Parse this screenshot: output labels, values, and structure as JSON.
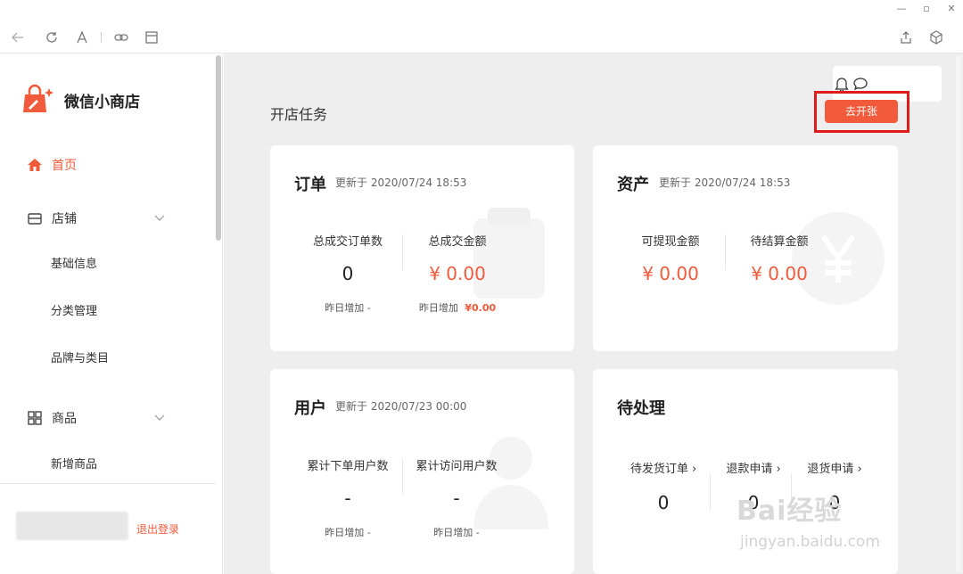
{
  "window": {
    "controls": [
      "minimize",
      "restore",
      "close"
    ]
  },
  "toolbar": {
    "icons": [
      "back-icon",
      "refresh-icon",
      "font-icon",
      "link-icon",
      "layout-icon",
      "share-icon",
      "cube-icon"
    ]
  },
  "sidebar": {
    "brand": "微信小商店",
    "nav": {
      "home": "首页",
      "store": "店铺",
      "store_sub": [
        "基础信息",
        "分类管理",
        "品牌与类目"
      ],
      "goods": "商品",
      "goods_sub": [
        "新增商品"
      ]
    },
    "logout": "退出登录"
  },
  "main": {
    "title": "开店任务",
    "open_button": "去开张",
    "cards": {
      "orders": {
        "title": "订单",
        "updated": "更新于  2020/07/24 18:53",
        "metrics": [
          {
            "label": "总成交订单数",
            "value": "0",
            "sub_label": "昨日增加",
            "sub_value": "-"
          },
          {
            "label": "总成交金额",
            "value": "¥ 0.00",
            "sub_label": "昨日增加",
            "sub_value": "¥0.00"
          }
        ]
      },
      "assets": {
        "title": "资产",
        "updated": "更新于  2020/07/24 18:53",
        "metrics": [
          {
            "label": "可提现金额",
            "value": "¥ 0.00"
          },
          {
            "label": "待结算金额",
            "value": "¥ 0.00"
          }
        ]
      },
      "users": {
        "title": "用户",
        "updated": "更新于  2020/07/23 00:00",
        "metrics": [
          {
            "label": "累计下单用户数",
            "value": "-",
            "sub_label": "昨日增加",
            "sub_value": "-"
          },
          {
            "label": "累计访问用户数",
            "value": "-",
            "sub_label": "昨日增加",
            "sub_value": "-"
          }
        ]
      },
      "pending": {
        "title": "待处理",
        "items": [
          {
            "label": "待发货订单 ›",
            "value": "0"
          },
          {
            "label": "退款申请 ›",
            "value": "0"
          },
          {
            "label": "退货申请 ›",
            "value": "0"
          }
        ]
      }
    }
  },
  "watermark": {
    "brand": "Bai经验",
    "url": "jingyan.baidu.com"
  },
  "colors": {
    "accent": "#f25a3c",
    "highlight_frame": "#e01b1b",
    "background": "#eeeeee"
  }
}
